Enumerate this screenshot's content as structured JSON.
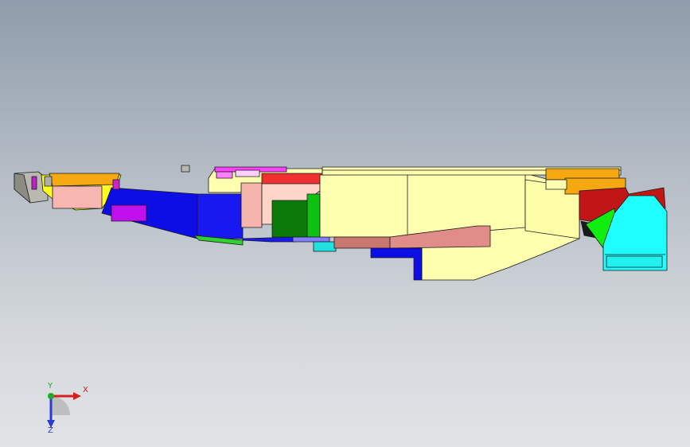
{
  "viewport": {
    "background_top": "#8f9cab",
    "background_bottom": "#e1e3e6"
  },
  "model": {
    "edge_color": "#1a1a1a"
  },
  "orientation_triad": {
    "x_label": "X",
    "y_label": "Y",
    "z_label": "Z",
    "x_color": "#d42020",
    "y_color": "#1faa2a",
    "z_color": "#2b3bd0"
  }
}
